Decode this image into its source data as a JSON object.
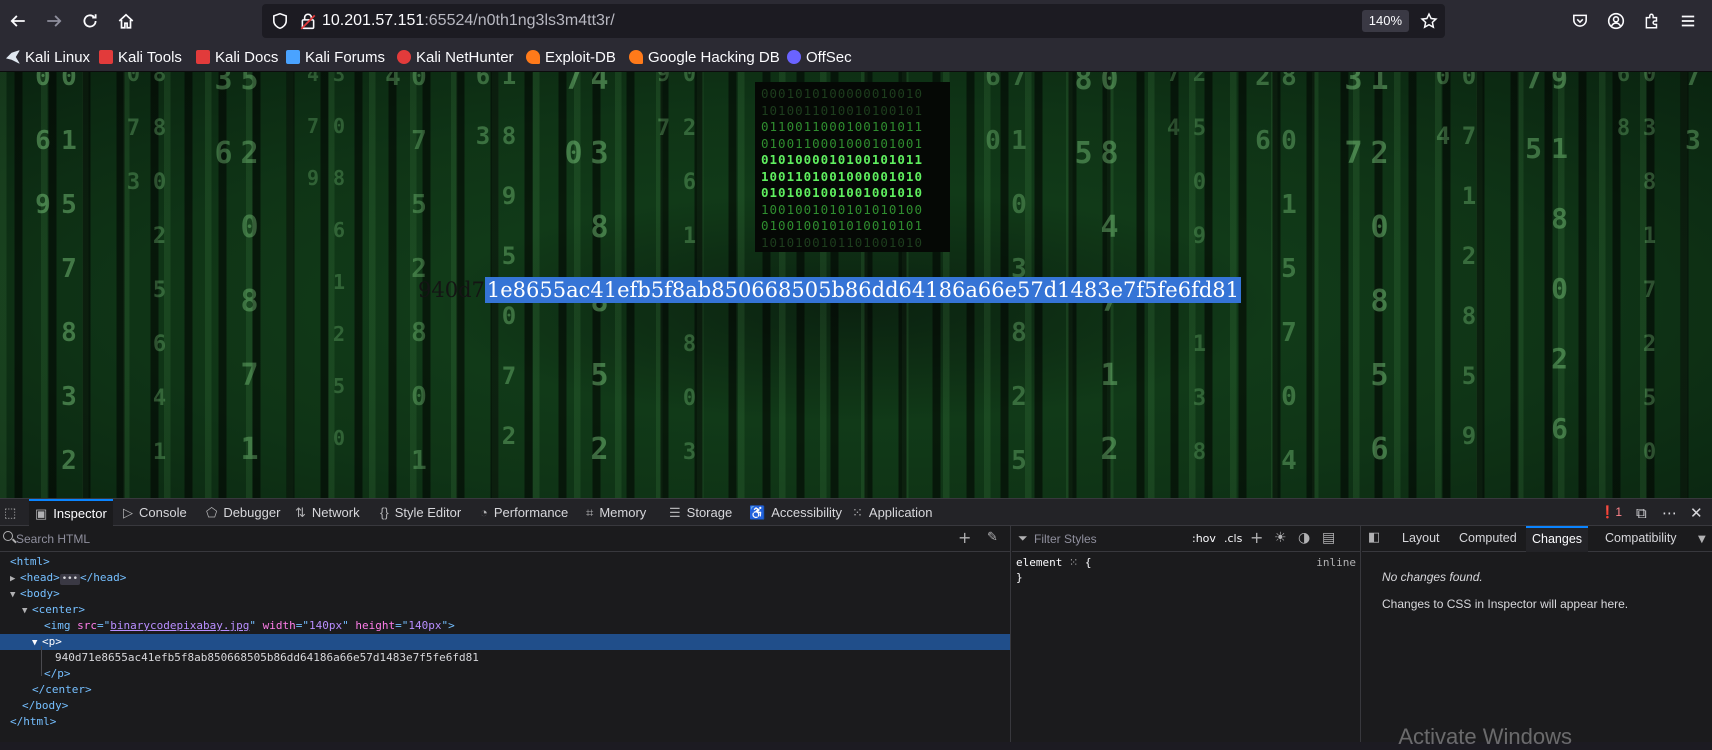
{
  "browser": {
    "url_host": "10.201.57.151",
    "url_rest": ":65524/n0th1ng3ls3m4tt3r/",
    "zoom": "140%",
    "icons": [
      "back-icon",
      "forward-icon",
      "reload-icon",
      "home-icon",
      "shield-icon",
      "lock-icon",
      "star-icon",
      "pocket-icon",
      "account-icon",
      "extensions-icon",
      "menu-icon"
    ]
  },
  "bookmarks": [
    {
      "label": "Kali Linux",
      "color": "#dfe7f0"
    },
    {
      "label": "Kali Tools",
      "color": "#e23b3b"
    },
    {
      "label": "Kali Docs",
      "color": "#e23b3b"
    },
    {
      "label": "Kali Forums",
      "color": "#4aa3ff"
    },
    {
      "label": "Kali NetHunter",
      "color": "#e23b3b"
    },
    {
      "label": "Exploit-DB",
      "color": "#ff7a1a"
    },
    {
      "label": "Google Hacking DB",
      "color": "#ff7a1a"
    },
    {
      "label": "OffSec",
      "color": "#6a63ff"
    }
  ],
  "page": {
    "hash_prefix": "940d7",
    "hash_selected": "1e8655ac41efb5f8ab850668505b86dd64186a66e57d1483e7f5fe6fd81",
    "image_rows": [
      {
        "text": "0001010100000010010",
        "tone": "faint"
      },
      {
        "text": "1010011010010100101",
        "tone": "faint"
      },
      {
        "text": "0110011000100101011",
        "tone": "dim"
      },
      {
        "text": "0100110001000101001",
        "tone": "dim"
      },
      {
        "text": "0101000010100101011",
        "tone": "bright"
      },
      {
        "text": "1001101001000001010",
        "tone": "bright"
      },
      {
        "text": "0101001001001001010",
        "tone": "bright"
      },
      {
        "text": "1001001010101010100",
        "tone": "dim"
      },
      {
        "text": "0100100101010010101",
        "tone": "dim"
      },
      {
        "text": "1010100101101001010",
        "tone": "faint"
      }
    ]
  },
  "devtools": {
    "tabs": [
      "Inspector",
      "Console",
      "Debugger",
      "Network",
      "Style Editor",
      "Performance",
      "Memory",
      "Storage",
      "Accessibility",
      "Application"
    ],
    "error_count": "1",
    "search_placeholder": "Search HTML",
    "tree": {
      "html_open": "<html>",
      "head": "<head>",
      "head_close": "</head>",
      "body_open": "<body>",
      "center_open": "<center>",
      "img_tag": "<img",
      "img_src_attr": "src",
      "img_src_val": "binarycodepixabay.jpg",
      "img_width_attr": "width",
      "img_width_val": "140px",
      "img_height_attr": "height",
      "img_height_val": "140px",
      "img_close": ">",
      "p_open": "<p>",
      "p_text": "940d71e8655ac41efb5f8ab850668505b86dd64186a66e57d1483e7f5fe6fd81",
      "p_close": "</p>",
      "center_close": "</center>",
      "body_close": "</body>",
      "html_close": "</html>"
    },
    "styles": {
      "filter_placeholder": "Filter Styles",
      "hov": ":hov",
      "cls": ".cls",
      "rule_selector": "element",
      "rule_open": "{",
      "rule_close": "}",
      "rule_source": "inline"
    },
    "right_tabs": [
      "Layout",
      "Computed",
      "Changes",
      "Compatibility"
    ],
    "changes_empty": "No changes found.",
    "changes_note": "Changes to CSS in Inspector will appear here."
  },
  "os_watermark": "Activate Windows"
}
